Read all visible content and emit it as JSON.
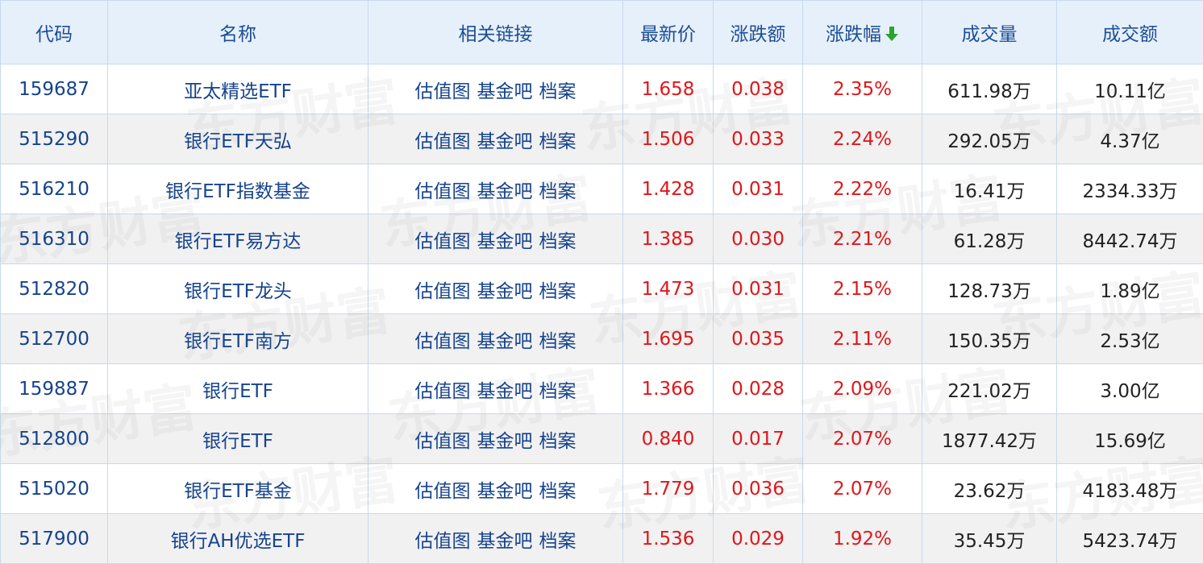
{
  "table": {
    "headers": {
      "code": "代码",
      "name": "名称",
      "links": "相关链接",
      "price": "最新价",
      "change": "涨跌额",
      "change_pct": "涨跌幅",
      "volume": "成交量",
      "amount": "成交额"
    },
    "sort_icon": "arrow-down-icon",
    "sort_color": "#2aa42d",
    "link_labels": [
      "估值图",
      "基金吧",
      "档案"
    ],
    "rows": [
      {
        "code": "159687",
        "name": "亚太精选ETF",
        "price": "1.658",
        "change": "0.038",
        "change_pct": "2.35%",
        "volume": "611.98万",
        "amount": "10.11亿"
      },
      {
        "code": "515290",
        "name": "银行ETF天弘",
        "price": "1.506",
        "change": "0.033",
        "change_pct": "2.24%",
        "volume": "292.05万",
        "amount": "4.37亿"
      },
      {
        "code": "516210",
        "name": "银行ETF指数基金",
        "price": "1.428",
        "change": "0.031",
        "change_pct": "2.22%",
        "volume": "16.41万",
        "amount": "2334.33万"
      },
      {
        "code": "516310",
        "name": "银行ETF易方达",
        "price": "1.385",
        "change": "0.030",
        "change_pct": "2.21%",
        "volume": "61.28万",
        "amount": "8442.74万"
      },
      {
        "code": "512820",
        "name": "银行ETF龙头",
        "price": "1.473",
        "change": "0.031",
        "change_pct": "2.15%",
        "volume": "128.73万",
        "amount": "1.89亿"
      },
      {
        "code": "512700",
        "name": "银行ETF南方",
        "price": "1.695",
        "change": "0.035",
        "change_pct": "2.11%",
        "volume": "150.35万",
        "amount": "2.53亿"
      },
      {
        "code": "159887",
        "name": "银行ETF",
        "price": "1.366",
        "change": "0.028",
        "change_pct": "2.09%",
        "volume": "221.02万",
        "amount": "3.00亿"
      },
      {
        "code": "512800",
        "name": "银行ETF",
        "price": "0.840",
        "change": "0.017",
        "change_pct": "2.07%",
        "volume": "1877.42万",
        "amount": "15.69亿"
      },
      {
        "code": "515020",
        "name": "银行ETF基金",
        "price": "1.779",
        "change": "0.036",
        "change_pct": "2.07%",
        "volume": "23.62万",
        "amount": "4183.48万"
      },
      {
        "code": "517900",
        "name": "银行AH优选ETF",
        "price": "1.536",
        "change": "0.029",
        "change_pct": "1.92%",
        "volume": "35.45万",
        "amount": "5423.74万"
      }
    ]
  },
  "watermark": "东方财富",
  "colors": {
    "header_bg": "#e6f0fb",
    "header_text": "#1d4e95",
    "link_text": "#16438d",
    "up_red": "#e0161a",
    "border": "#c8d9ec",
    "alt_row": "#f1f1f1"
  }
}
